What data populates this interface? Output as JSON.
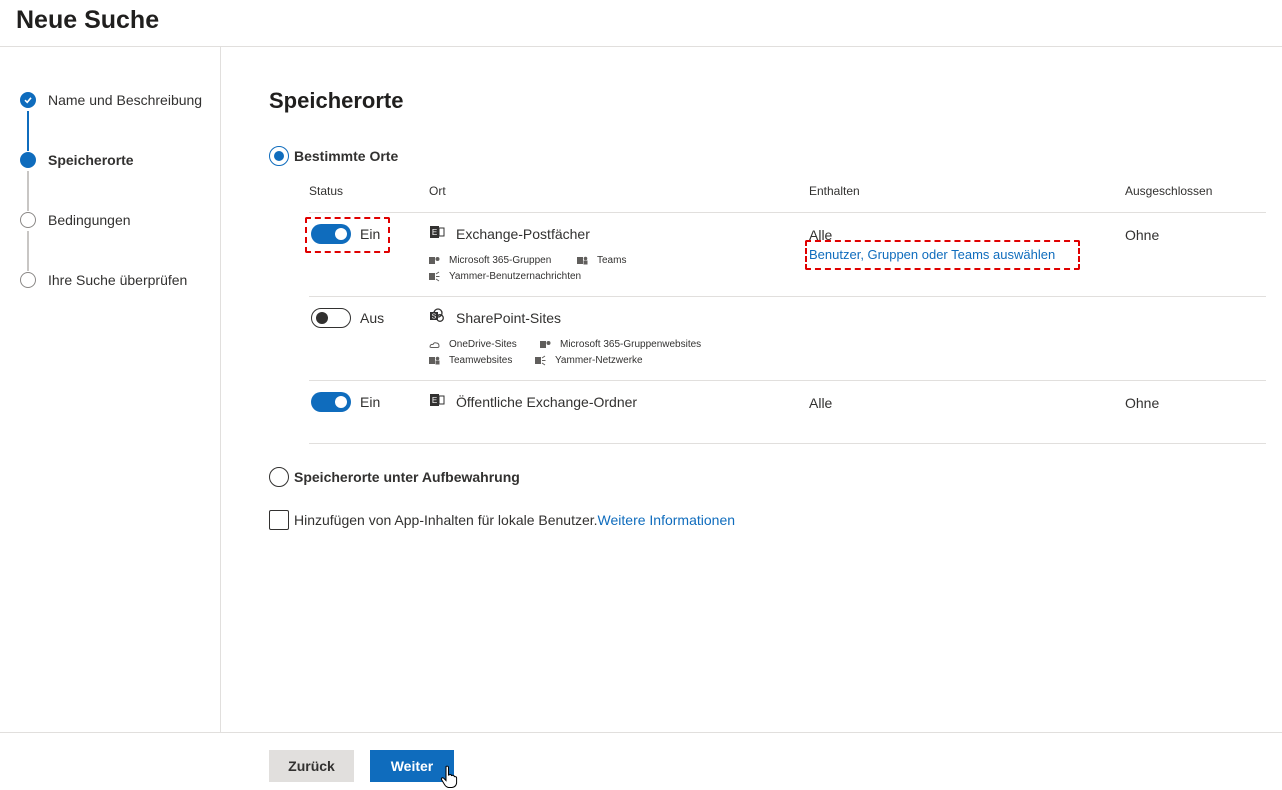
{
  "header": {
    "title": "Neue Suche"
  },
  "steps": [
    {
      "label": "Name und Beschreibung",
      "state": "done"
    },
    {
      "label": "Speicherorte",
      "state": "current"
    },
    {
      "label": "Bedingungen",
      "state": "pending"
    },
    {
      "label": "Ihre Suche überprüfen",
      "state": "pending"
    }
  ],
  "main": {
    "title": "Speicherorte",
    "radio_specific": {
      "label": "Bestimmte Orte",
      "checked": true
    },
    "radio_hold": {
      "label": "Speicherorte unter Aufbewahrung",
      "checked": false
    },
    "table": {
      "columns": [
        "Status",
        "Ort",
        "Enthalten",
        "Ausgeschlossen"
      ],
      "rows": [
        {
          "status": "Ein",
          "on": true,
          "location": "Exchange-Postfächer",
          "icon": "exchange-icon",
          "sub_items": [
            {
              "label": "Microsoft 365-Gruppen",
              "icon": "groups-icon"
            },
            {
              "label": "Teams",
              "icon": "teams-icon"
            },
            {
              "label": "Yammer-Benutzernachrichten",
              "icon": "yammer-icon"
            }
          ],
          "included": "Alle",
          "included_link": "Benutzer, Gruppen oder Teams auswählen",
          "excluded": "Ohne"
        },
        {
          "status": "Aus",
          "on": false,
          "location": "SharePoint-Sites",
          "icon": "sharepoint-icon",
          "sub_items": [
            {
              "label": "OneDrive-Sites",
              "icon": "onedrive-icon"
            },
            {
              "label": "Microsoft 365-Gruppenwebsites",
              "icon": "groups-icon"
            },
            {
              "label": "Teamwebsites",
              "icon": "teams-icon"
            },
            {
              "label": "Yammer-Netzwerke",
              "icon": "yammer-icon"
            }
          ],
          "included": "",
          "excluded": ""
        },
        {
          "status": "Ein",
          "on": true,
          "location": "Öffentliche Exchange-Ordner",
          "icon": "exchange-icon",
          "sub_items": [],
          "included": "Alle",
          "excluded": "Ohne"
        }
      ]
    },
    "checkbox": {
      "label": "Hinzufügen von App-Inhalten für lokale Benutzer.",
      "link": "Weitere Informationen",
      "checked": false
    }
  },
  "footer": {
    "back_label": "Zurück",
    "next_label": "Weiter"
  },
  "colors": {
    "accent": "#0f6cbd",
    "highlight": "#e00000",
    "border": "#e1dfdd"
  }
}
